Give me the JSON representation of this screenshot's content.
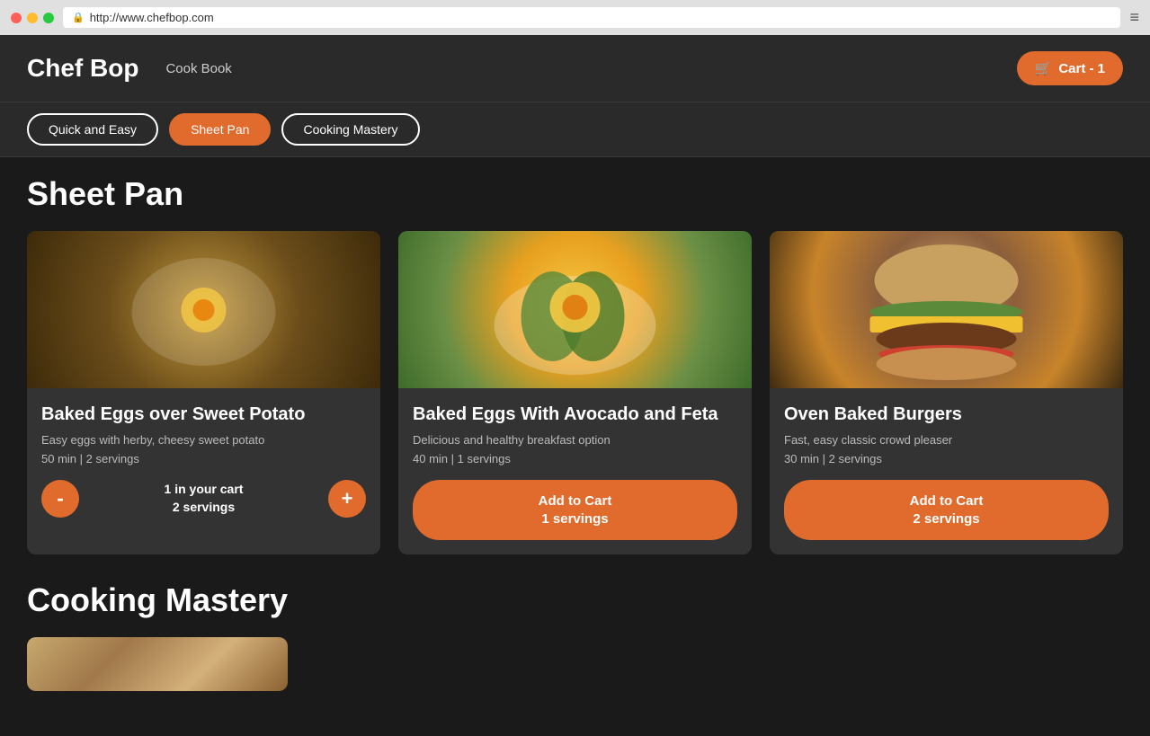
{
  "browser": {
    "url": "http://www.chefbop.com",
    "url_icon": "🔒"
  },
  "header": {
    "logo": "Chef Bop",
    "nav": [
      {
        "label": "Cook Book"
      }
    ],
    "cart_label": "Cart - 1",
    "cart_icon": "🛒"
  },
  "category_nav": {
    "items": [
      {
        "label": "Quick and Easy",
        "active": false
      },
      {
        "label": "Sheet Pan",
        "active": true
      },
      {
        "label": "Cooking Mastery",
        "active": false
      }
    ]
  },
  "sections": [
    {
      "title": "Sheet Pan",
      "cards": [
        {
          "title": "Baked Eggs over Sweet Potato",
          "description": "Easy eggs with herby, cheesy sweet potato",
          "meta": "50 min | 2 servings",
          "in_cart": true,
          "cart_count": "1 in your cart",
          "cart_servings": "2 servings",
          "img_color": "#8B6914",
          "img_gradient": "radial-gradient(circle at 50% 50%, #c49a3c, #6b4d1a, #3d2a0a)"
        },
        {
          "title": "Baked Eggs With Avocado and Feta",
          "description": "Delicious and healthy breakfast option",
          "meta": "40 min | 1 servings",
          "in_cart": false,
          "add_label": "Add to Cart",
          "add_servings": "1 servings",
          "img_color": "#4a7a3d",
          "img_gradient": "radial-gradient(circle at 50% 45%, #f5c842, #e8a020, #6b8f45, #3d6b2a)"
        },
        {
          "title": "Oven Baked Burgers",
          "description": "Fast, easy classic crowd pleaser",
          "meta": "30 min | 2 servings",
          "in_cart": false,
          "add_label": "Add to Cart",
          "add_servings": "2 servings",
          "img_color": "#8B5e3c",
          "img_gradient": "radial-gradient(circle at 50% 40%, #d4a870, #8b5e3c, #c8842a, #3d2a10)"
        }
      ]
    },
    {
      "title": "Cooking Mastery",
      "partial": true
    }
  ]
}
